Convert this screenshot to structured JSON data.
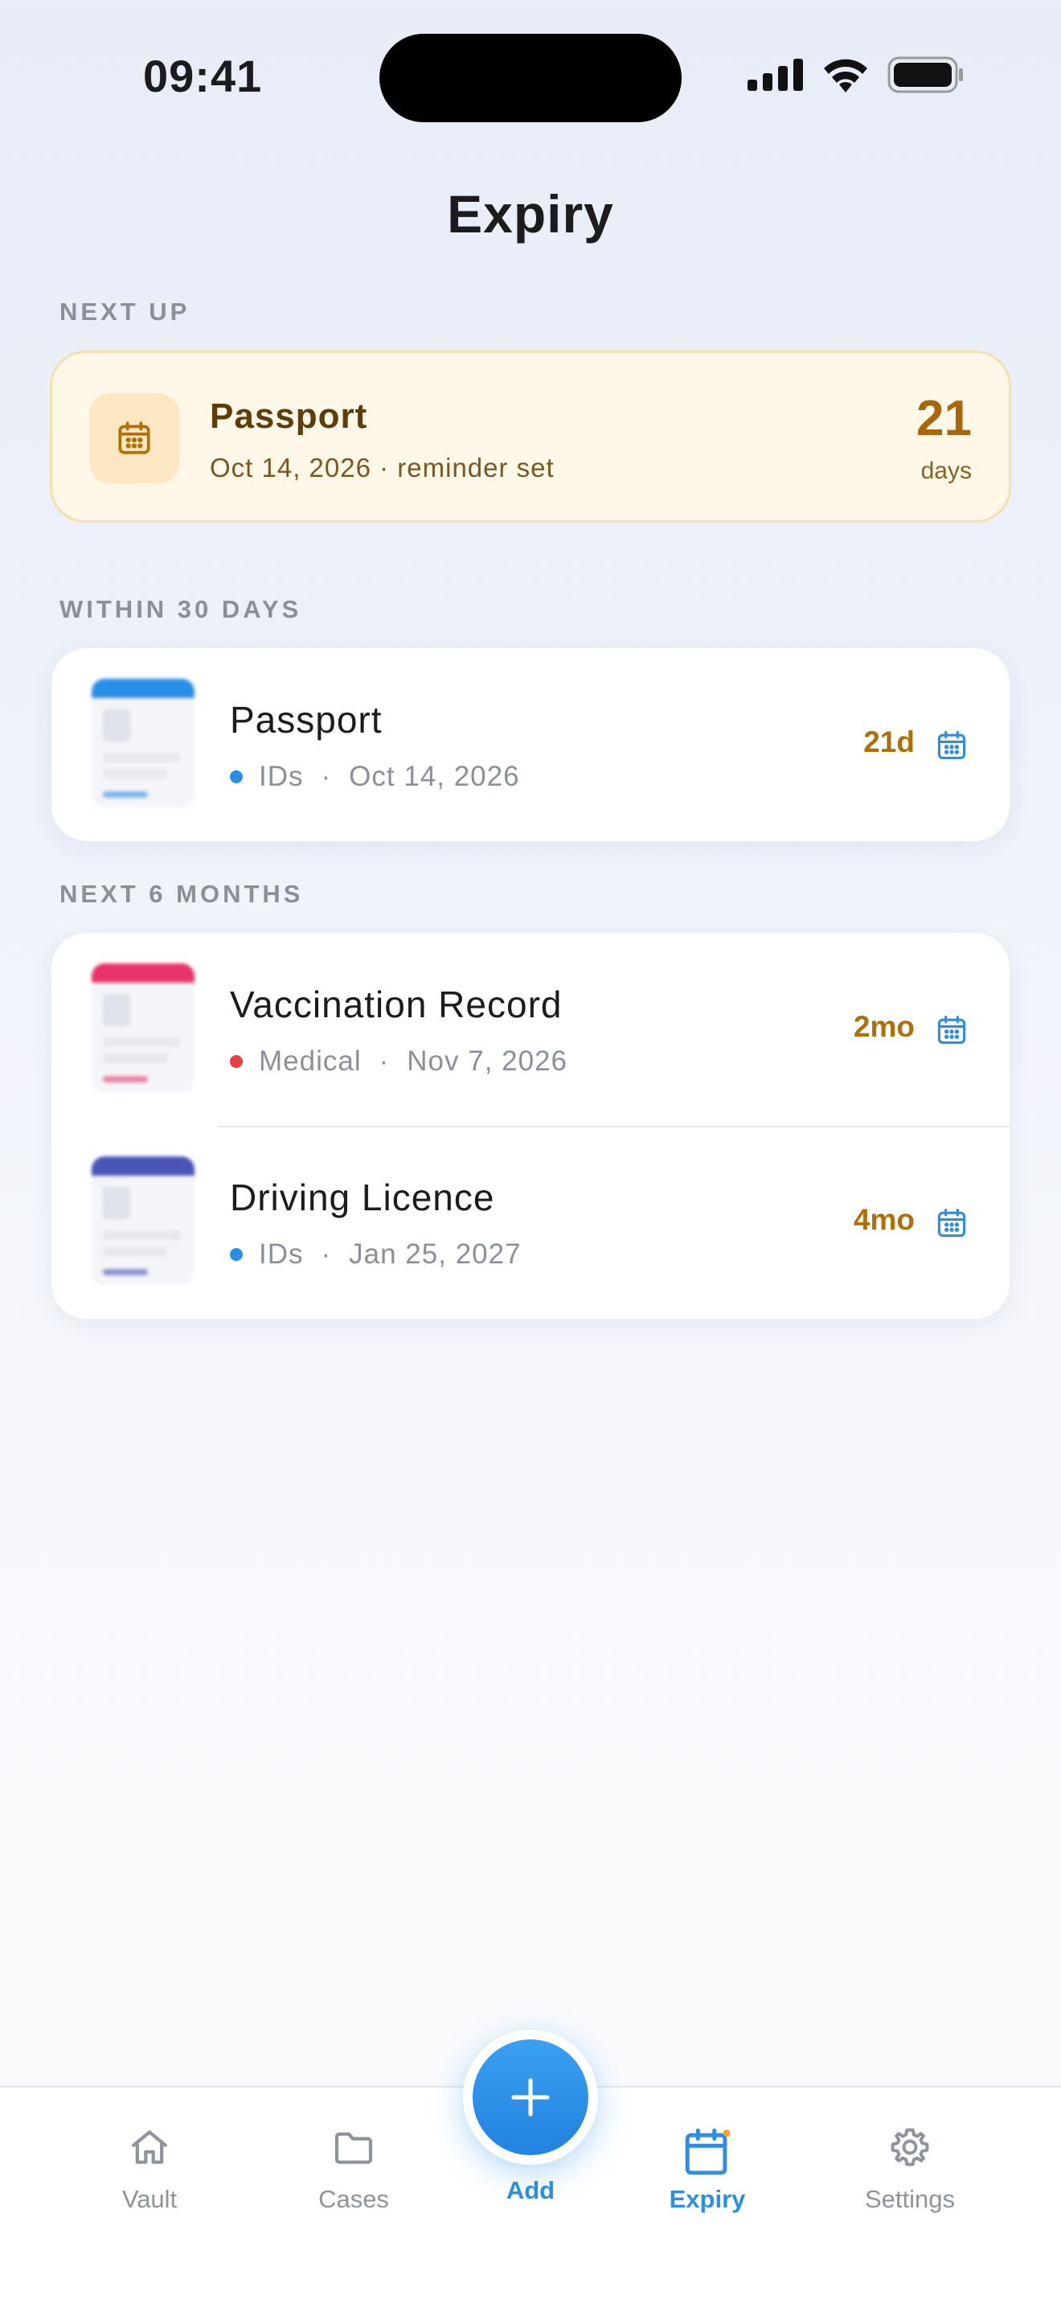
{
  "status_bar": {
    "time": "09:41"
  },
  "header": {
    "title": "Expiry"
  },
  "next_up": {
    "section_label": "NEXT UP",
    "title": "Passport",
    "subtitle": "Oct 14, 2026 · reminder set",
    "count": "21",
    "unit": "days",
    "icon": "calendar-icon"
  },
  "within_30": {
    "section_label": "WITHIN 30 DAYS",
    "items": [
      {
        "title": "Passport",
        "category": "IDs",
        "date": "Oct 14, 2026",
        "badge": "21d",
        "category_color": "#2b8ee6",
        "band_color": "#2b8ee6"
      }
    ]
  },
  "next_6_months": {
    "section_label": "NEXT 6 MONTHS",
    "items": [
      {
        "title": "Vaccination Record",
        "category": "Medical",
        "date": "Nov 7, 2026",
        "badge": "2mo",
        "category_color": "#e84040",
        "band_color": "#e8346a"
      },
      {
        "title": "Driving Licence",
        "category": "IDs",
        "date": "Jan 25, 2027",
        "badge": "4mo",
        "category_color": "#2b8ee6",
        "band_color": "#4a55b8"
      }
    ]
  },
  "meta_separator": "·",
  "tabs": {
    "vault": "Vault",
    "cases": "Cases",
    "add": "Add",
    "expiry": "Expiry",
    "settings": "Settings"
  },
  "colors": {
    "accent": "#2b8ee6",
    "warning": "#b07008",
    "notify_dot": "#f4a62a"
  }
}
